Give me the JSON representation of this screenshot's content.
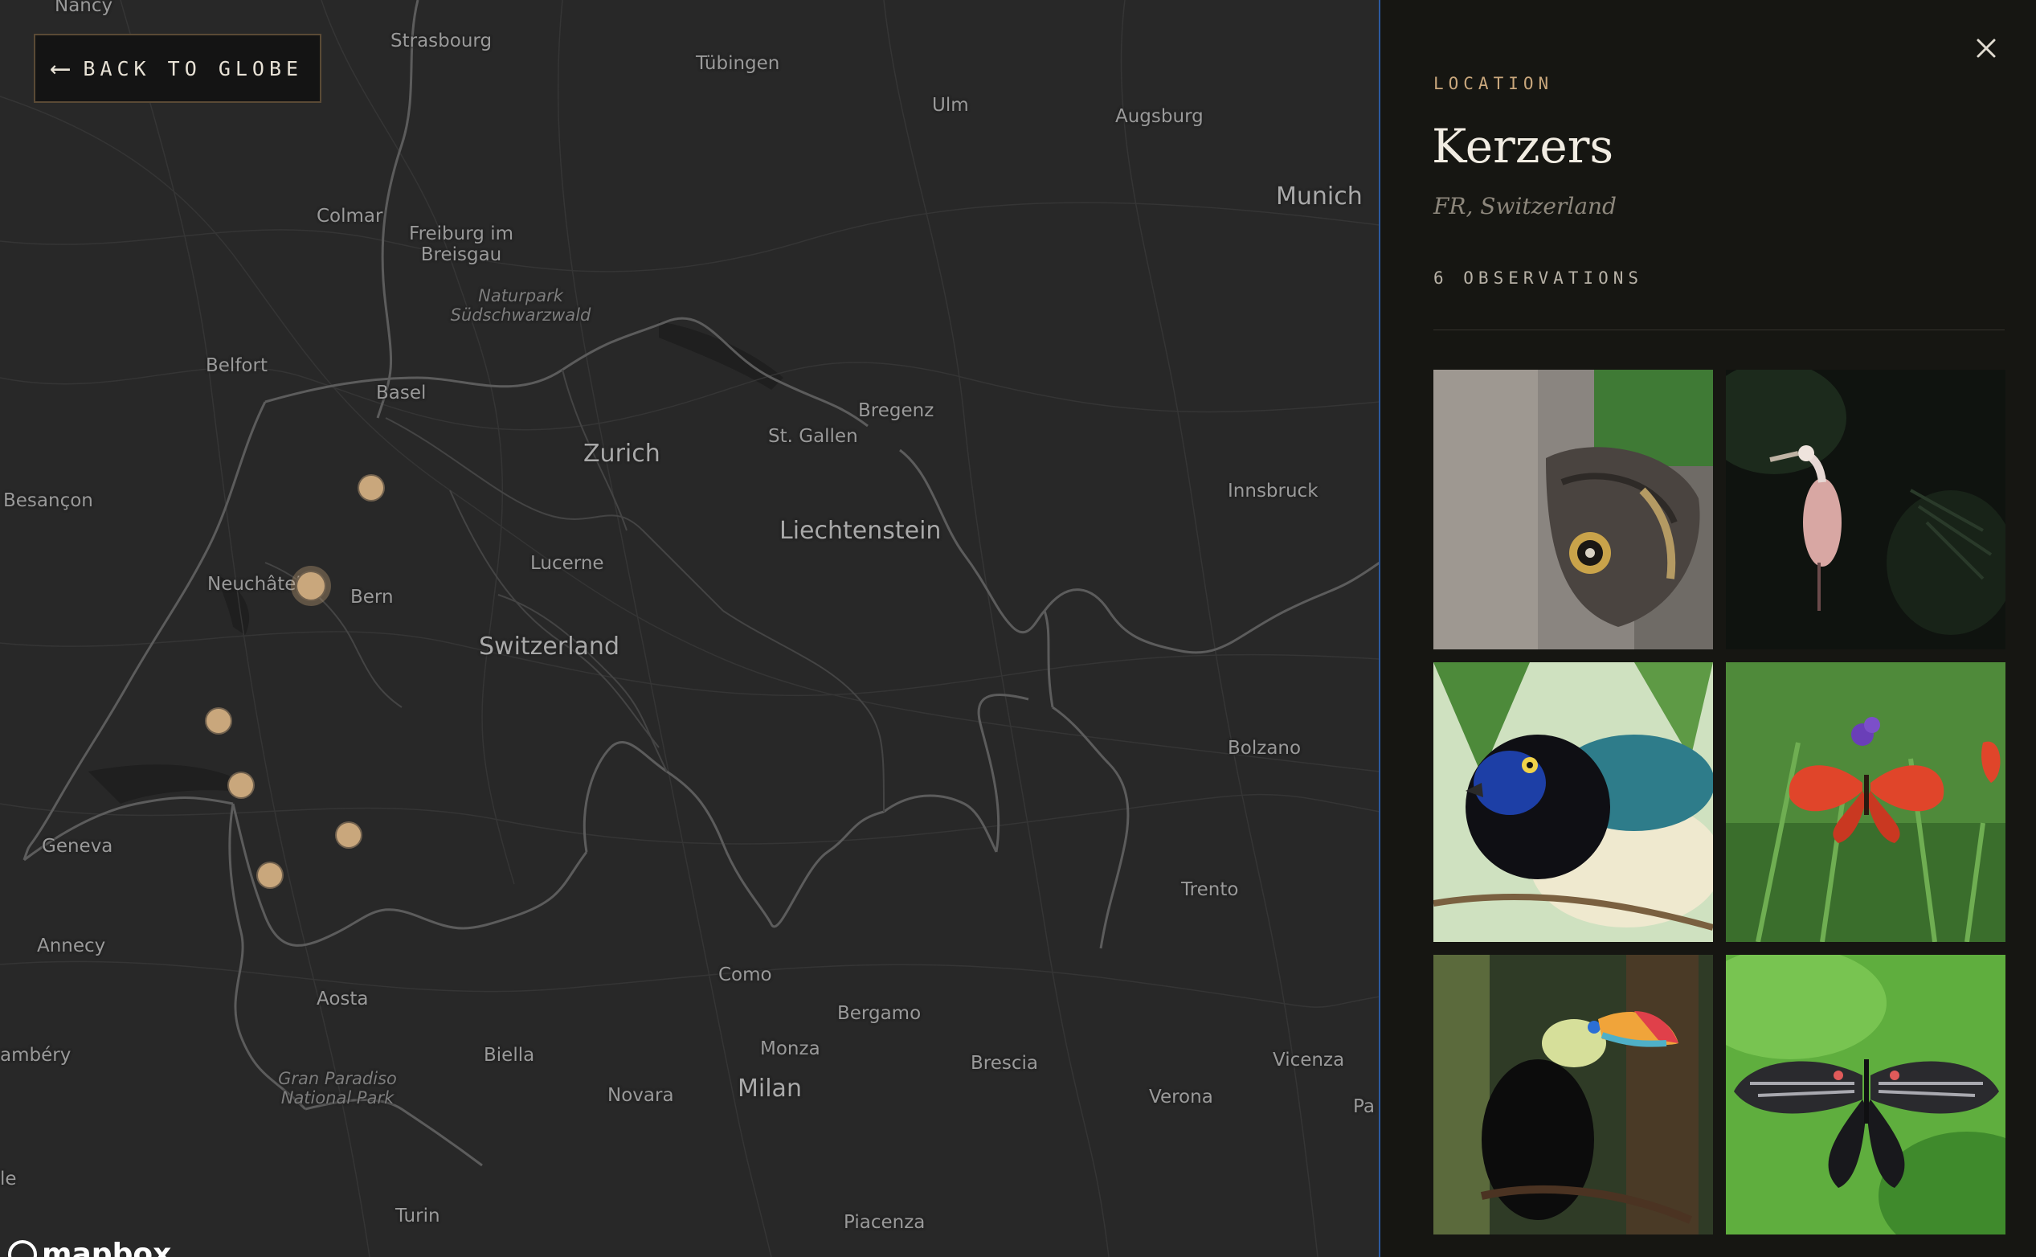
{
  "map": {
    "back_button_label": "BACK TO GLOBE",
    "attribution": "mapbox",
    "places": {
      "nancy": "Nancy",
      "strasbourg": "Strasbourg",
      "tubingen": "Tübingen",
      "ulm": "Ulm",
      "augsburg": "Augsburg",
      "munich": "Munich",
      "colmar": "Colmar",
      "freiburg": "Freiburg im\nBreisgau",
      "naturpark": "Naturpark\nSüdschwarzwald",
      "belfort": "Belfort",
      "basel": "Basel",
      "zurich": "Zurich",
      "st_gallen": "St. Gallen",
      "bregenz": "Bregenz",
      "liechtenstein": "Liechtenstein",
      "innsbruck": "Innsbruck",
      "besancon": "Besançon",
      "neuchatel": "Neuchâtel",
      "bern": "Bern",
      "lucerne": "Lucerne",
      "switzerland": "Switzerland",
      "bolzano": "Bolzano",
      "geneva": "Geneva",
      "trento": "Trento",
      "annecy": "Annecy",
      "aosta": "Aosta",
      "como": "Como",
      "bergamo": "Bergamo",
      "chambery": "ambéry",
      "biella": "Biella",
      "monza": "Monza",
      "brescia": "Brescia",
      "vicenza": "Vicenza",
      "gran_paradiso": "Gran Paradiso\nNational Park",
      "novara": "Novara",
      "milan": "Milan",
      "verona": "Verona",
      "pad": "Pa",
      "le": "le",
      "turin": "Turin",
      "piacenza": "Piacenza"
    },
    "marker_color": "#c9a77c"
  },
  "panel": {
    "label": "LOCATION",
    "title": "Kerzers",
    "subtitle": "FR, Switzerland",
    "count": "6 OBSERVATIONS",
    "accent_color": "#c9a77c",
    "photos": [
      {
        "subject": "owl butterfly on tree trunk"
      },
      {
        "subject": "roseate spoonbill in dark foliage"
      },
      {
        "subject": "blue-headed bird (great blue turaco-like)"
      },
      {
        "subject": "orange butterflies on purple flowers"
      },
      {
        "subject": "toucan on branch"
      },
      {
        "subject": "black and red swallowtail butterfly"
      }
    ]
  },
  "icons": {
    "back": "arrow-left-icon",
    "close": "close-icon",
    "attribution": "mapbox-logo-icon"
  }
}
